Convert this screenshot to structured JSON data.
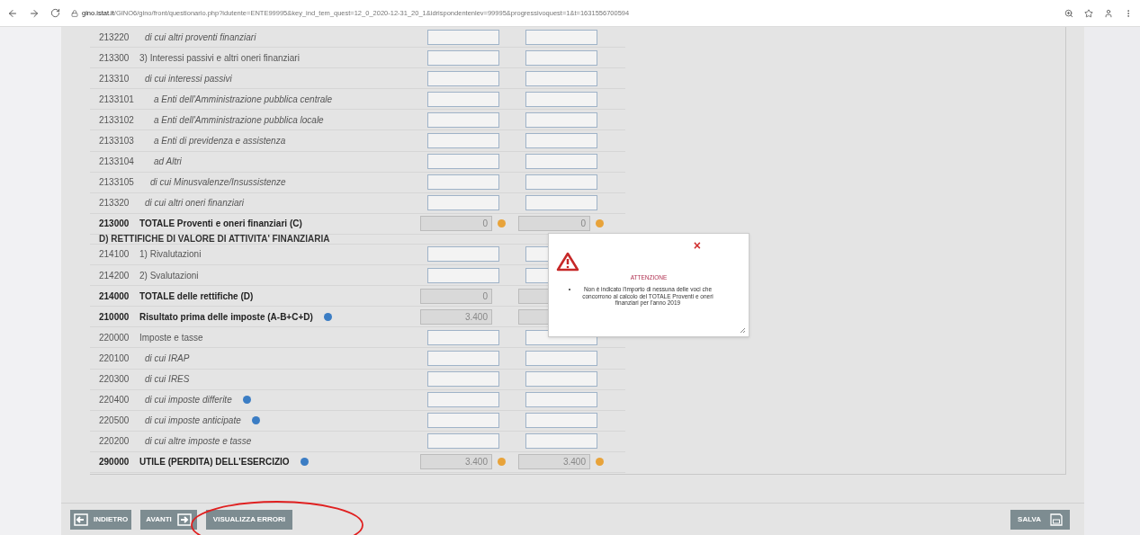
{
  "browser": {
    "url_host": "gino.istat.it",
    "url_path": "/GINO6/gino/front/questionario.php?idutente=ENTE99995&key_ind_tem_quest=12_0_2020-12-31_20_1&idrispondentenlev=99995&progressivoquest=1&t=1631556700594"
  },
  "rows": [
    {
      "kind": "sub",
      "code": "213220",
      "label": "di cui altri proventi finanziari",
      "fields": [
        {
          "readonly": false
        },
        {
          "readonly": false
        }
      ]
    },
    {
      "kind": "plain",
      "code": "213300",
      "label": "3) Interessi passivi e altri oneri finanziari",
      "fields": [
        {
          "readonly": false
        },
        {
          "readonly": false
        }
      ]
    },
    {
      "kind": "sub",
      "code": "213310",
      "label": "di cui interessi passivi",
      "fields": [
        {
          "readonly": false
        },
        {
          "readonly": false
        }
      ]
    },
    {
      "kind": "subsub",
      "code": "2133101",
      "label": "a Enti dell'Amministrazione pubblica centrale",
      "fields": [
        {
          "readonly": false
        },
        {
          "readonly": false
        }
      ]
    },
    {
      "kind": "subsub",
      "code": "2133102",
      "label": "a Enti dell'Amministrazione pubblica locale",
      "fields": [
        {
          "readonly": false
        },
        {
          "readonly": false
        }
      ]
    },
    {
      "kind": "subsub",
      "code": "2133103",
      "label": "a Enti di previdenza e assistenza",
      "fields": [
        {
          "readonly": false
        },
        {
          "readonly": false
        }
      ]
    },
    {
      "kind": "subsub",
      "code": "2133104",
      "label": "ad Altri",
      "fields": [
        {
          "readonly": false
        },
        {
          "readonly": false
        }
      ]
    },
    {
      "kind": "submid",
      "code": "2133105",
      "label": "di cui Minusvalenze/Insussistenze",
      "fields": [
        {
          "readonly": false
        },
        {
          "readonly": false
        }
      ]
    },
    {
      "kind": "sub",
      "code": "213320",
      "label": "di cui altri oneri finanziari",
      "fields": [
        {
          "readonly": false
        },
        {
          "readonly": false
        }
      ]
    },
    {
      "kind": "total",
      "code": "213000",
      "label": "TOTALE Proventi e oneri finanziari (C)",
      "fields": [
        {
          "readonly": true,
          "value": "0",
          "warning": true
        },
        {
          "readonly": true,
          "value": "0",
          "warning": true
        }
      ]
    },
    {
      "kind": "section",
      "label": "D) RETTIFICHE DI VALORE DI ATTIVITA' FINANZIARIA"
    },
    {
      "kind": "plain",
      "code": "214100",
      "label": "1) Rivalutazioni",
      "fields": [
        {
          "readonly": false
        },
        {
          "readonly": false
        }
      ]
    },
    {
      "kind": "plain",
      "code": "214200",
      "label": "2) Svalutazioni",
      "fields": [
        {
          "readonly": false
        },
        {
          "readonly": false
        }
      ]
    },
    {
      "kind": "total",
      "code": "214000",
      "label": "TOTALE delle rettifiche (D)",
      "fields": [
        {
          "readonly": true,
          "value": "0",
          "warning": false
        },
        {
          "readonly": true,
          "warning": false
        }
      ]
    },
    {
      "kind": "total",
      "code": "210000",
      "label": "Risultato prima delle imposte (A-B+C+D)",
      "info": true,
      "fields": [
        {
          "readonly": true,
          "value": "3.400",
          "warning": false
        },
        {
          "readonly": true,
          "warning": false
        }
      ]
    },
    {
      "kind": "plain",
      "code": "220000",
      "label": "Imposte e tasse",
      "fields": [
        {
          "readonly": false
        },
        {
          "readonly": false
        }
      ]
    },
    {
      "kind": "sub",
      "code": "220100",
      "label": "di cui IRAP",
      "fields": [
        {
          "readonly": false
        },
        {
          "readonly": false
        }
      ]
    },
    {
      "kind": "sub",
      "code": "220300",
      "label": "di cui IRES",
      "fields": [
        {
          "readonly": false
        },
        {
          "readonly": false
        }
      ]
    },
    {
      "kind": "sub",
      "code": "220400",
      "label": "di cui imposte differite",
      "info": true,
      "fields": [
        {
          "readonly": false
        },
        {
          "readonly": false
        }
      ]
    },
    {
      "kind": "sub",
      "code": "220500",
      "label": "di cui imposte anticipate",
      "info": true,
      "fields": [
        {
          "readonly": false
        },
        {
          "readonly": false
        }
      ]
    },
    {
      "kind": "sub",
      "code": "220200",
      "label": "di cui altre imposte e tasse",
      "fields": [
        {
          "readonly": false
        },
        {
          "readonly": false
        }
      ]
    },
    {
      "kind": "total",
      "code": "290000",
      "label": "UTILE (PERDITA) DELL'ESERCIZIO",
      "info": true,
      "fields": [
        {
          "readonly": true,
          "value": "3.400",
          "warning": true
        },
        {
          "readonly": true,
          "value": "3.400",
          "warning": true
        }
      ]
    }
  ],
  "dialog": {
    "close": "×",
    "title": "ATTENZIONE",
    "messages": [
      "Non è indicato l'importo di nessuna delle voci che concorrono al calcolo del TOTALE Proventi e oneri finanziari per l'anno 2019"
    ]
  },
  "footer": {
    "back": "INDIETRO",
    "next": "AVANTI",
    "errors": "VISUALIZZA ERRORI",
    "save": "SALVA",
    "errors_circled": true
  }
}
